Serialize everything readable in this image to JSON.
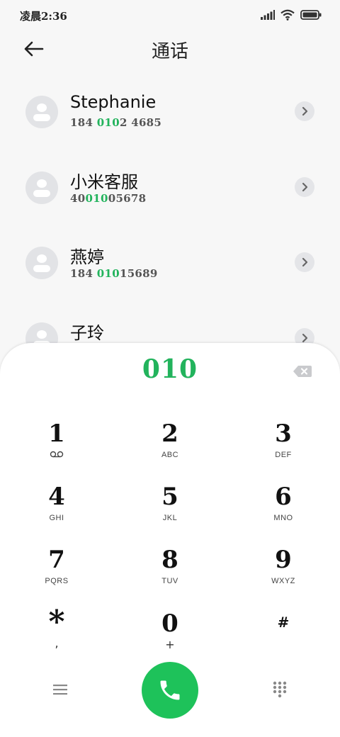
{
  "status_bar": {
    "time": "凌晨2:36",
    "icons": [
      "signal-icon",
      "wifi-icon",
      "battery-icon"
    ]
  },
  "header": {
    "title": "通话",
    "back_icon": "arrow-left-icon"
  },
  "contacts": [
    {
      "name": "Stephanie",
      "number_pre": "184 ",
      "number_match": "010",
      "number_post": "2 4685"
    },
    {
      "name": "小米客服",
      "number_pre": "40",
      "number_match": "010",
      "number_post": "05678"
    },
    {
      "name": "燕婷",
      "number_pre": "184 ",
      "number_match": "010",
      "number_post": "15689"
    },
    {
      "name": "子玲",
      "number_pre": "",
      "number_match": "",
      "number_post": ""
    }
  ],
  "dialer": {
    "input_value": "010",
    "keys": [
      {
        "digit": "1",
        "sub": "voicemail-icon"
      },
      {
        "digit": "2",
        "sub": "ABC"
      },
      {
        "digit": "3",
        "sub": "DEF"
      },
      {
        "digit": "4",
        "sub": "GHI"
      },
      {
        "digit": "5",
        "sub": "JKL"
      },
      {
        "digit": "6",
        "sub": "MNO"
      },
      {
        "digit": "7",
        "sub": "PQRS"
      },
      {
        "digit": "8",
        "sub": "TUV"
      },
      {
        "digit": "9",
        "sub": "WXYZ"
      },
      {
        "digit": "*",
        "sub": ","
      },
      {
        "digit": "0",
        "sub": "+"
      },
      {
        "digit": "#",
        "sub": ""
      }
    ],
    "bottom_icons": [
      "menu-icon",
      "phone-icon",
      "keypad-icon"
    ]
  },
  "colors": {
    "accent_green": "#22b35c",
    "call_button": "#1ec25a",
    "avatar_bg": "#e2e3e6"
  }
}
